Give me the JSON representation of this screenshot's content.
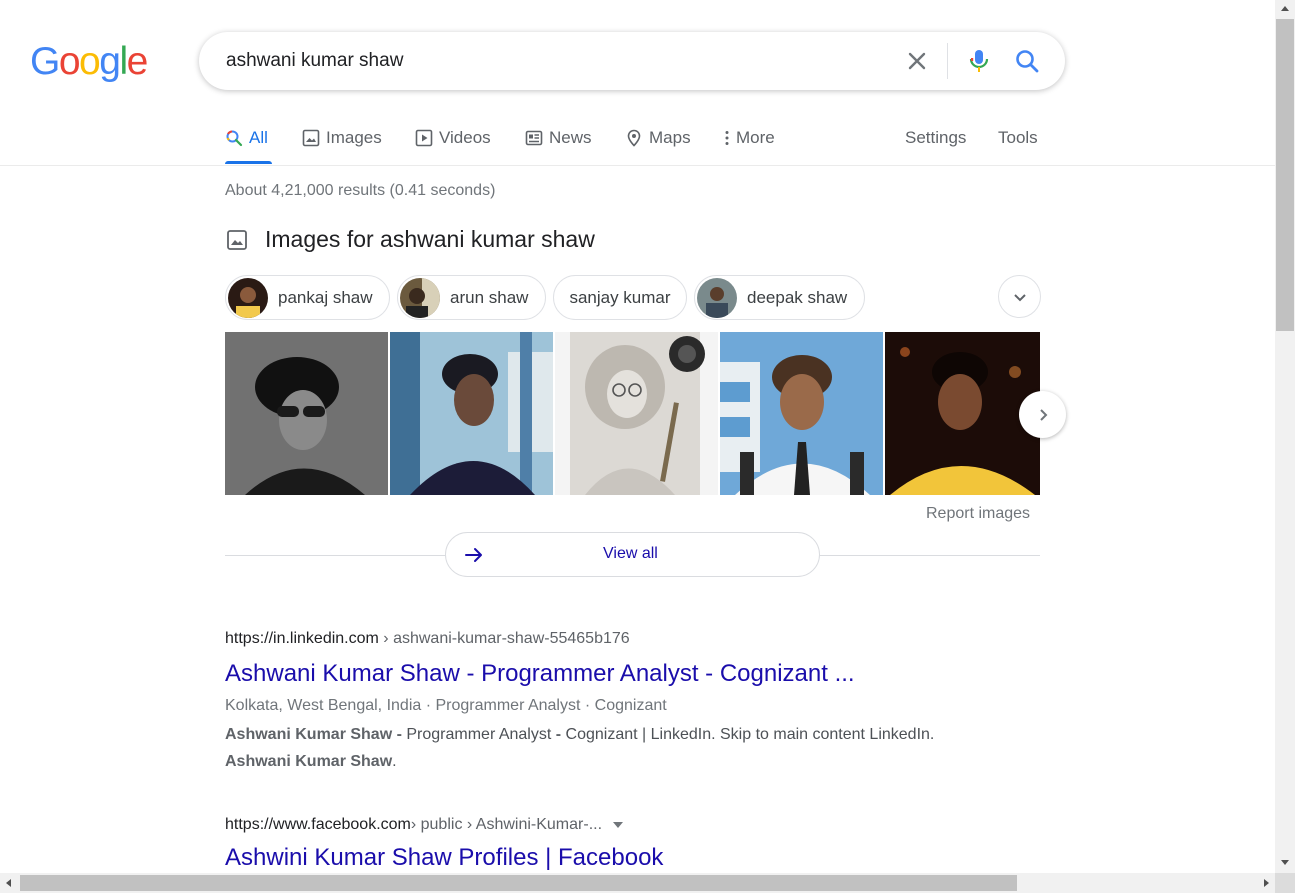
{
  "logo": {
    "text": "Google"
  },
  "search": {
    "query": "ashwani kumar shaw"
  },
  "tabs": [
    {
      "label": "All",
      "icon": "search-icon"
    },
    {
      "label": "Images",
      "icon": "image-icon"
    },
    {
      "label": "Videos",
      "icon": "play-icon"
    },
    {
      "label": "News",
      "icon": "news-icon"
    },
    {
      "label": "Maps",
      "icon": "pin-icon"
    },
    {
      "label": "More",
      "icon": "more-vert-icon"
    }
  ],
  "tools": {
    "settings": "Settings",
    "tools": "Tools"
  },
  "stats": "About 4,21,000 results (0.41 seconds)",
  "images_section": {
    "title": "Images for ashwani kumar shaw",
    "chips": [
      {
        "label": "pankaj shaw"
      },
      {
        "label": "arun shaw"
      },
      {
        "label": "sanjay kumar"
      },
      {
        "label": "deepak shaw"
      }
    ],
    "report": "Report images",
    "view_all": "View all"
  },
  "results": [
    {
      "url_host": "https://in.linkedin.com",
      "url_path": " › ashwani-kumar-shaw-55465b176",
      "title": "Ashwani Kumar Shaw - Programmer Analyst - Cognizant ...",
      "meta": "Kolkata, West Bengal, India · Programmer Analyst · Cognizant",
      "snippet_b1": "Ashwani Kumar Shaw -",
      "snippet_t1": " Programmer Analyst ",
      "snippet_b2": "-",
      "snippet_t2": " Cognizant | LinkedIn. Skip to main content LinkedIn. ",
      "snippet_b3": "Ashwani Kumar Shaw",
      "snippet_t3": "."
    },
    {
      "url_host": "https://www.facebook.com",
      "url_path": " › public › Ashwini-Kumar-...",
      "title": "Ashwini Kumar Shaw Profiles | Facebook"
    }
  ],
  "colors": {
    "link": "#1a0dab",
    "accent": "#1a73e8",
    "grey": "#70757a"
  }
}
